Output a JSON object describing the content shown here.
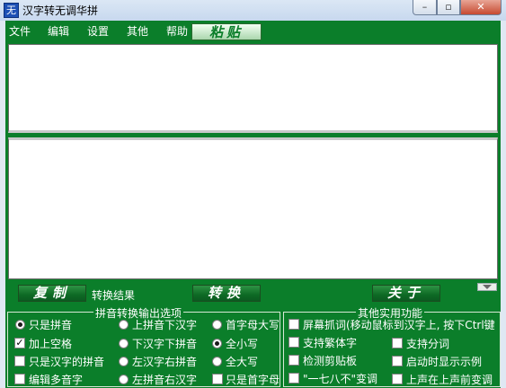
{
  "window": {
    "title": "汉字转无调华拼",
    "icon_char": "无",
    "minimize": "–",
    "maximize": "▫",
    "close": "✕"
  },
  "menu": {
    "items": [
      {
        "label": "文件"
      },
      {
        "label": "编辑"
      },
      {
        "label": "设置"
      },
      {
        "label": "其他"
      },
      {
        "label": "帮助"
      }
    ],
    "paste_label": "粘贴"
  },
  "buttons": {
    "copy": "复制",
    "convert": "转换",
    "about": "关于",
    "result_label": "转换结果"
  },
  "output_options": {
    "title": "拼音转换输出选项",
    "radios": [
      {
        "label": "只是拼音",
        "checked": true
      },
      {
        "label": "上拼音下汉字",
        "checked": false
      },
      {
        "label": "首字母大写",
        "checked": false
      },
      {
        "label": "下汉字下拼音",
        "checked": false
      },
      {
        "label": "全小写",
        "checked": true
      },
      {
        "label": "左汉字右拼音",
        "checked": false
      },
      {
        "label": "全大写",
        "checked": false
      },
      {
        "label": "左拼音右汉字",
        "checked": false
      }
    ],
    "checks": [
      {
        "label": "加上空格",
        "checked": true
      },
      {
        "label": "只是汉字的拼音",
        "checked": false
      },
      {
        "label": "编辑多音字",
        "checked": false
      },
      {
        "label": "只是首字母",
        "checked": false
      }
    ]
  },
  "utility_options": {
    "title": "其他实用功能",
    "checks": [
      {
        "label": "屏幕抓词(移动鼠标到汉字上, 按下Ctrl键",
        "checked": false
      },
      {
        "label": "支持繁体字",
        "checked": false
      },
      {
        "label": "支持分词",
        "checked": false
      },
      {
        "label": "检测剪贴板",
        "checked": false
      },
      {
        "label": "启动时显示示例",
        "checked": false
      },
      {
        "label": "\"一七八不\"变调",
        "checked": false
      },
      {
        "label": "上声在上声前变调",
        "checked": false
      }
    ]
  }
}
